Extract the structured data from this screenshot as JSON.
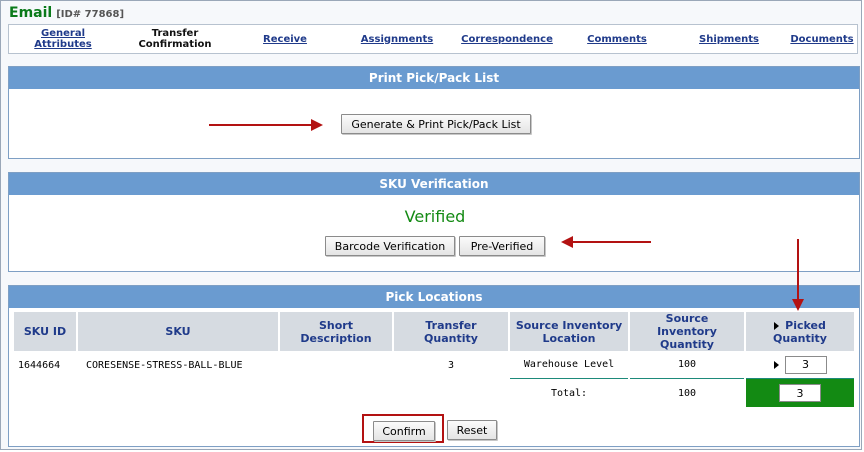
{
  "header": {
    "title": "Email",
    "id_label": "[ID# 77868]"
  },
  "tabs": [
    {
      "label": "General Attributes",
      "current": false
    },
    {
      "label": "Transfer Confirmation",
      "current": true
    },
    {
      "label": "Receive",
      "current": false
    },
    {
      "label": "Assignments",
      "current": false
    },
    {
      "label": "Correspondence",
      "current": false
    },
    {
      "label": "Comments",
      "current": false
    },
    {
      "label": "Shipments",
      "current": false
    },
    {
      "label": "Documents",
      "current": false
    }
  ],
  "print_section": {
    "title": "Print Pick/Pack List",
    "generate_button": "Generate & Print Pick/Pack List"
  },
  "sku_section": {
    "title": "SKU Verification",
    "status": "Verified",
    "barcode_button": "Barcode Verification",
    "preverified_button": "Pre-Verified"
  },
  "pick_section": {
    "title": "Pick Locations",
    "columns": [
      "SKU ID",
      "SKU",
      "Short Description",
      "Transfer Quantity",
      "Source Inventory Location",
      "Source Inventory Quantity",
      "Picked Quantity"
    ],
    "row": {
      "sku_id": "1644664",
      "sku": "CORESENSE-STRESS-BALL-BLUE",
      "short_description": "",
      "transfer_quantity": "3",
      "source_location": "Warehouse Level",
      "source_quantity": "100",
      "picked_quantity": "3"
    },
    "total": {
      "label": "Total:",
      "source_quantity": "100",
      "picked_quantity": "3"
    },
    "confirm_button": "Confirm",
    "reset_button": "Reset"
  },
  "colors": {
    "header_bar": "#6a9bd0",
    "verified": "#138a13",
    "annotation_arrow": "#b31212",
    "total_picked_bg": "#138a13"
  }
}
